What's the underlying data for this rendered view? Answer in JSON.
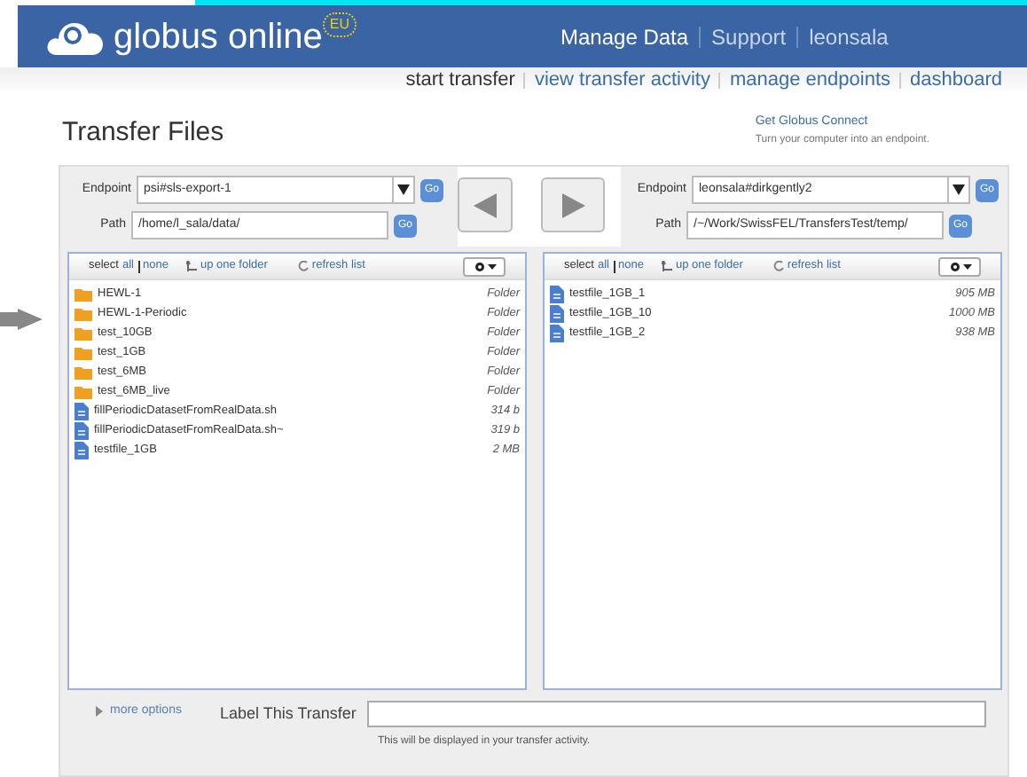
{
  "header": {
    "logo_text": "globus online",
    "badge": "EU",
    "nav": [
      {
        "label": "Manage Data",
        "selected": true
      },
      {
        "label": "Support",
        "selected": false
      },
      {
        "label": "leonsala",
        "selected": false
      }
    ]
  },
  "subnav": [
    {
      "label": "start transfer",
      "selected": true
    },
    {
      "label": "view transfer activity",
      "selected": false
    },
    {
      "label": "manage endpoints",
      "selected": false
    },
    {
      "label": "dashboard",
      "selected": false
    }
  ],
  "title": "Transfer Files",
  "connect": {
    "link": "Get Globus Connect",
    "note": "Turn your computer into an endpoint."
  },
  "panes": [
    {
      "endpoint_label": "Endpoint",
      "endpoint": "psi#sls-export-1",
      "path_label": "Path",
      "path": "/home/l_sala/data/",
      "go": "Go",
      "path_go": "Go",
      "toolbar": {
        "select": "select",
        "all": "all",
        "none": "none",
        "up": "up one folder",
        "refresh": "refresh list"
      },
      "files": [
        {
          "kind": "folder",
          "name": "HEWL-1",
          "size": "Folder"
        },
        {
          "kind": "folder",
          "name": "HEWL-1-Periodic",
          "size": "Folder"
        },
        {
          "kind": "folder",
          "name": "test_10GB",
          "size": "Folder"
        },
        {
          "kind": "folder",
          "name": "test_1GB",
          "size": "Folder"
        },
        {
          "kind": "folder",
          "name": "test_6MB",
          "size": "Folder"
        },
        {
          "kind": "folder",
          "name": "test_6MB_live",
          "size": "Folder"
        },
        {
          "kind": "file",
          "name": "fillPeriodicDatasetFromRealData.sh",
          "size": "314 b"
        },
        {
          "kind": "file",
          "name": "fillPeriodicDatasetFromRealData.sh~",
          "size": "319 b"
        },
        {
          "kind": "file",
          "name": "testfile_1GB",
          "size": "2 MB"
        }
      ]
    },
    {
      "endpoint_label": "Endpoint",
      "endpoint": "leonsala#dirkgently2",
      "path_label": "Path",
      "path": "/~/Work/SwissFEL/TransfersTest/temp/",
      "go": "Go",
      "path_go": "Go",
      "toolbar": {
        "select": "select",
        "all": "all",
        "none": "none",
        "up": "up one folder",
        "refresh": "refresh list"
      },
      "files": [
        {
          "kind": "file",
          "name": "testfile_1GB_1",
          "size": "905 MB"
        },
        {
          "kind": "file",
          "name": "testfile_1GB_10",
          "size": "1000 MB"
        },
        {
          "kind": "file",
          "name": "testfile_1GB_2",
          "size": "938 MB"
        }
      ]
    }
  ],
  "footer": {
    "more_options": "more options",
    "label": "Label This Transfer",
    "hint": "This will be displayed in your transfer activity."
  }
}
